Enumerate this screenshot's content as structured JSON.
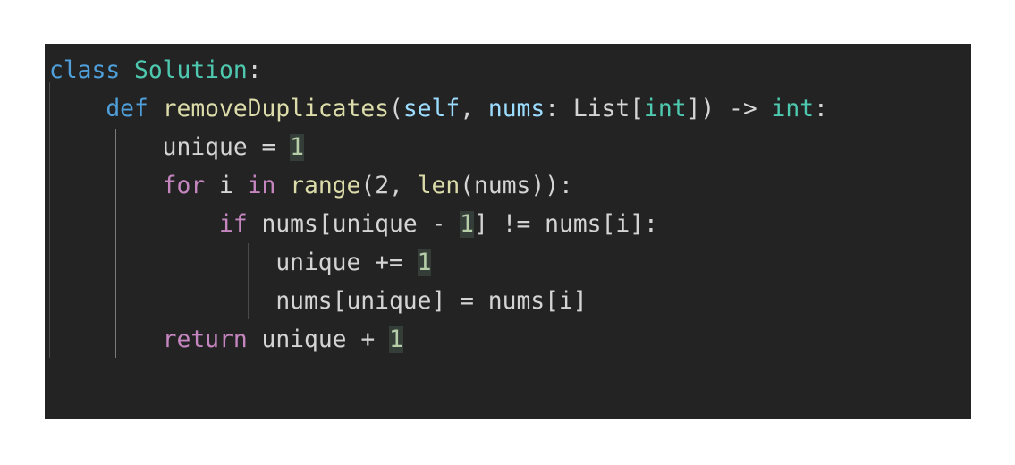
{
  "code": {
    "lines": [
      {
        "tokens": [
          {
            "t": "class",
            "c": "kw-blue"
          },
          {
            "t": " ",
            "c": "op"
          },
          {
            "t": "Solution",
            "c": "cls"
          },
          {
            "t": ":",
            "c": "op"
          }
        ]
      },
      {
        "tokens": [
          {
            "t": "    ",
            "c": "op"
          },
          {
            "t": "def",
            "c": "kw-blue"
          },
          {
            "t": " ",
            "c": "op"
          },
          {
            "t": "removeDuplicates",
            "c": "fn"
          },
          {
            "t": "(",
            "c": "op"
          },
          {
            "t": "self",
            "c": "param"
          },
          {
            "t": ", ",
            "c": "op"
          },
          {
            "t": "nums",
            "c": "param"
          },
          {
            "t": ": List[",
            "c": "op"
          },
          {
            "t": "int",
            "c": "cls"
          },
          {
            "t": "]) -> ",
            "c": "op"
          },
          {
            "t": "int",
            "c": "cls"
          },
          {
            "t": ":",
            "c": "op"
          }
        ]
      },
      {
        "tokens": [
          {
            "t": "        unique = ",
            "c": "op"
          },
          {
            "t": "1",
            "c": "num"
          }
        ]
      },
      {
        "tokens": [
          {
            "t": "        ",
            "c": "op"
          },
          {
            "t": "for",
            "c": "kw"
          },
          {
            "t": " i ",
            "c": "op"
          },
          {
            "t": "in",
            "c": "kw"
          },
          {
            "t": " ",
            "c": "op"
          },
          {
            "t": "range",
            "c": "fn"
          },
          {
            "t": "(2, ",
            "c": "op"
          },
          {
            "t": "len",
            "c": "fn"
          },
          {
            "t": "(nums)):",
            "c": "op"
          }
        ]
      },
      {
        "tokens": [
          {
            "t": "            ",
            "c": "op"
          },
          {
            "t": "if",
            "c": "kw"
          },
          {
            "t": " nums[unique - ",
            "c": "op"
          },
          {
            "t": "1",
            "c": "num"
          },
          {
            "t": "] != nums[i]:",
            "c": "op"
          }
        ]
      },
      {
        "tokens": [
          {
            "t": "                unique += ",
            "c": "op"
          },
          {
            "t": "1",
            "c": "num"
          }
        ]
      },
      {
        "tokens": [
          {
            "t": "                nums[unique] = nums[i]",
            "c": "op"
          }
        ]
      },
      {
        "tokens": [
          {
            "t": "        ",
            "c": "op"
          },
          {
            "t": "return",
            "c": "kw"
          },
          {
            "t": " unique + ",
            "c": "op"
          },
          {
            "t": "1",
            "c": "num"
          }
        ]
      }
    ]
  }
}
